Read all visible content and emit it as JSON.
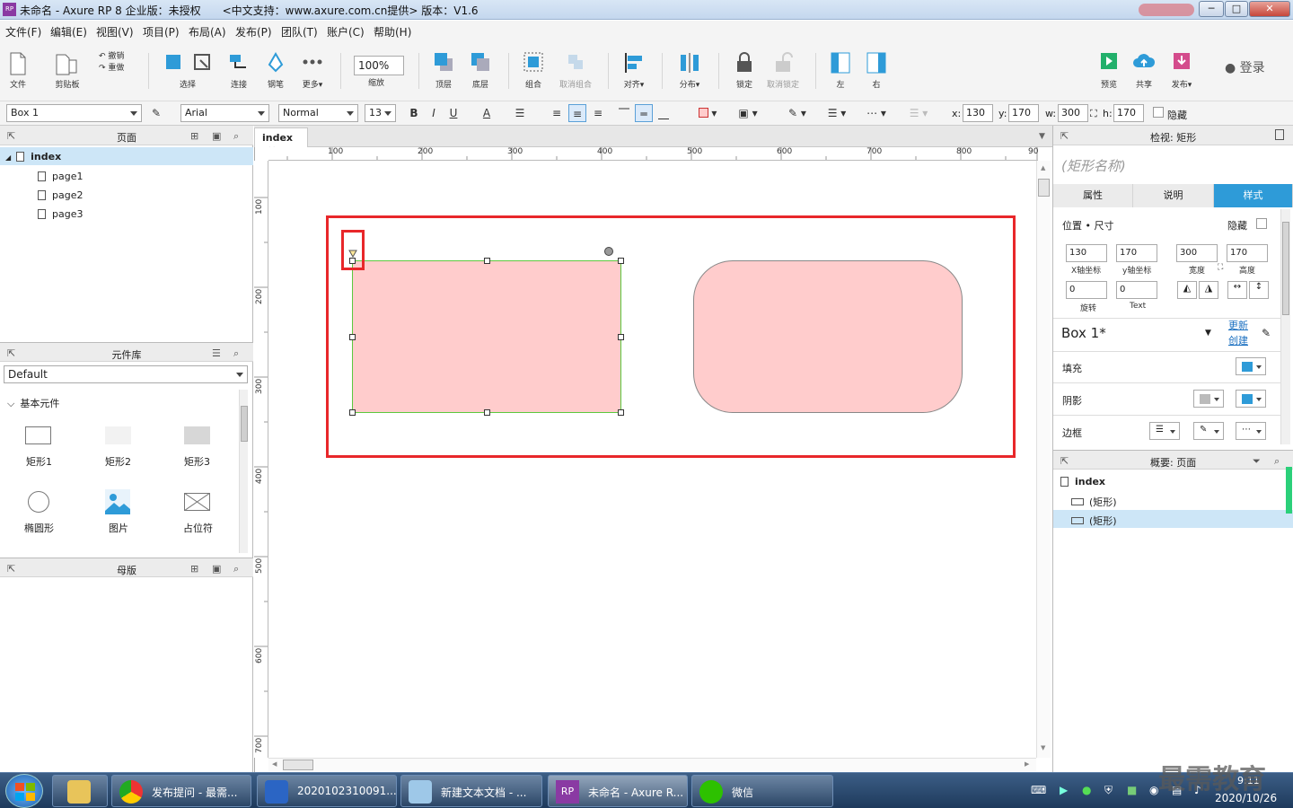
{
  "window": {
    "title": "未命名 - Axure RP 8 企业版：未授权　　<中文支持：www.axure.com.cn提供> 版本：V1.6",
    "app_icon": "RP",
    "minimize": "─",
    "maximize": "□",
    "close": "✕"
  },
  "menu": [
    "文件(F)",
    "编辑(E)",
    "视图(V)",
    "项目(P)",
    "布局(A)",
    "发布(P)",
    "团队(T)",
    "账户(C)",
    "帮助(H)"
  ],
  "toolbar": {
    "file": "文件",
    "clipboard": "剪贴板",
    "undo": "撤销",
    "redo": "重做",
    "select": "选择",
    "connect": "连接",
    "pen": "钢笔",
    "more": "更多▾",
    "zoom_value": "100%",
    "zoom": "缩放",
    "top": "顶层",
    "bottom": "底层",
    "group": "组合",
    "ungroup": "取消组合",
    "align": "对齐▾",
    "distribute": "分布▾",
    "lock": "锁定",
    "unlock": "取消锁定",
    "left": "左",
    "right": "右",
    "preview": "预览",
    "share": "共享",
    "publish": "发布▾",
    "login": "登录"
  },
  "format": {
    "widget_name": "Box 1",
    "font": "Arial",
    "style": "Normal",
    "size": "13",
    "bold": "B",
    "italic": "I",
    "underline": "U",
    "font_color": "A",
    "x_label": "x:",
    "x": "130",
    "y_label": "y:",
    "y": "170",
    "w_label": "w:",
    "w": "300",
    "h_label": "h:",
    "h": "170",
    "hide": "隐藏"
  },
  "pages_panel": {
    "title": "页面",
    "root": "index",
    "items": [
      "page1",
      "page2",
      "page3"
    ]
  },
  "library_panel": {
    "title": "元件库",
    "selected": "Default",
    "group": "基本元件",
    "widgets": [
      "矩形1",
      "矩形2",
      "矩形3",
      "椭圆形",
      "图片",
      "占位符"
    ]
  },
  "masters_panel": {
    "title": "母版"
  },
  "canvas": {
    "tab": "index",
    "tab_close": "×",
    "ruler_h": [
      "100",
      "200",
      "300",
      "400",
      "500",
      "600",
      "700",
      "800",
      "90"
    ],
    "ruler_v": [
      "100",
      "200",
      "300",
      "400",
      "500",
      "600",
      "700"
    ],
    "shape_fill": "#ffcccc",
    "highlight_color": "#e8272a",
    "selection_color": "#5cc83e"
  },
  "inspector": {
    "title": "检视: 矩形",
    "shape_name_placeholder": "(矩形名称)",
    "tabs": [
      "属性",
      "说明",
      "样式"
    ],
    "pos_size": "位置 • 尺寸",
    "hide": "隐藏",
    "x": "130",
    "y": "170",
    "w": "300",
    "h": "170",
    "x_label": "X轴坐标",
    "y_label": "y轴坐标",
    "w_label": "宽度",
    "h_label": "高度",
    "rotate": "0",
    "text_rotate": "0",
    "rotate_label": "旋转",
    "text_label": "Text",
    "style_name": "Box 1*",
    "update": "更新",
    "create": "创建",
    "fill": "填充",
    "shadow": "阴影",
    "border": "边框",
    "accent": "#2e9bd8"
  },
  "outline": {
    "title": "概要: 页面",
    "root": "index",
    "items": [
      "(矩形)",
      "(矩形)"
    ]
  },
  "taskbar": {
    "items": [
      "发布提问 - 最需...",
      "2020102310091...",
      "新建文本文档 - ...",
      "未命名 - Axure R...",
      "微信"
    ],
    "rp_badge": "RP",
    "clock": "2020/10/26",
    "time": "9:11",
    "watermark": "最需教育"
  }
}
